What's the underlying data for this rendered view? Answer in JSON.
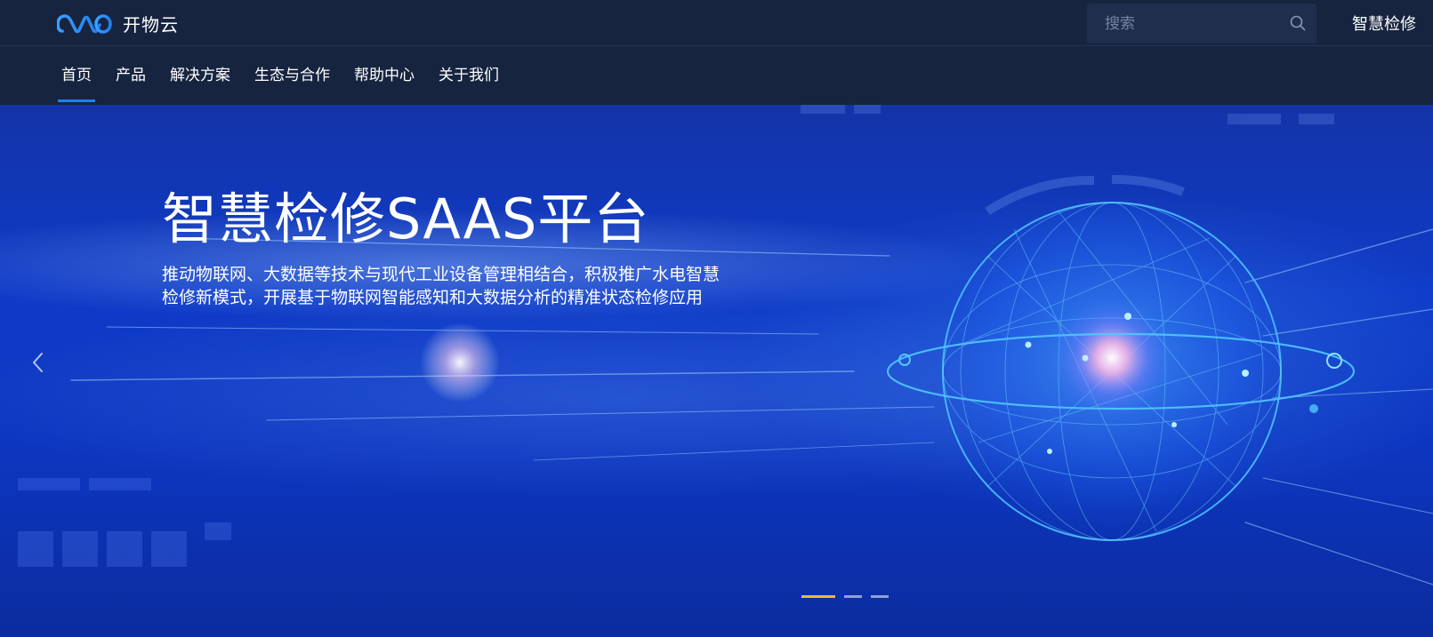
{
  "brand": {
    "name": "开物云",
    "logo_icon": "kaiwu-logo-icon",
    "accent_color": "#1e7ff0"
  },
  "search": {
    "placeholder": "搜索",
    "icon": "search-icon"
  },
  "topbar": {
    "link_label": "智慧检修"
  },
  "nav": {
    "items": [
      {
        "label": "首页",
        "active": true
      },
      {
        "label": "产品",
        "active": false
      },
      {
        "label": "解决方案",
        "active": false
      },
      {
        "label": "生态与合作",
        "active": false
      },
      {
        "label": "帮助中心",
        "active": false
      },
      {
        "label": "关于我们",
        "active": false
      }
    ]
  },
  "banner": {
    "title": "智慧检修SAAS平台",
    "description_lines": [
      "推动物联网、大数据等技术与现代工业设备管理相结合，积极推广水电智慧",
      "检修新模式，开展基于物联网智能感知和大数据分析的精准状态检修应用"
    ],
    "prev_icon": "chevron-left-icon",
    "slide_count": 3,
    "active_slide": 1,
    "active_dot_color": "#f5b631"
  }
}
